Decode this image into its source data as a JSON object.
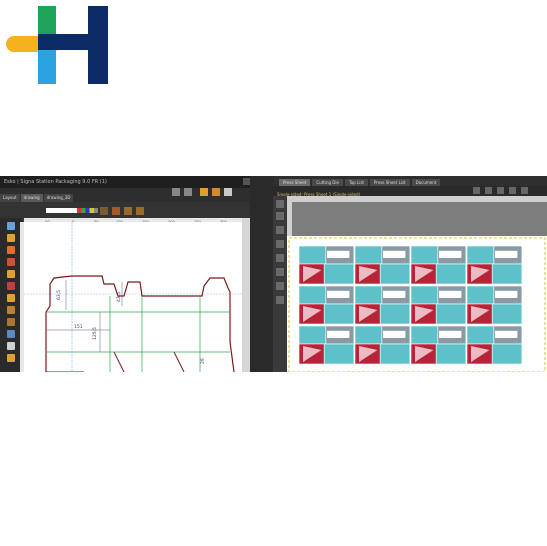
{
  "logo": {
    "name": "H brand logo",
    "colors": [
      "#f5b21c",
      "#2aa3e0",
      "#0b2a66"
    ]
  },
  "left_window": {
    "title": "Esko | Signa Station Packaging 9.0 FR (1)",
    "tabs": [
      "Layout",
      "drawing",
      "drawing_3D"
    ],
    "ruler_ticks": [
      "-50",
      "0",
      "50",
      "100",
      "150",
      "200",
      "250",
      "300"
    ],
    "dimensions": [
      "63,5",
      "43,5",
      "151",
      "125,5",
      "29"
    ]
  },
  "right_window": {
    "tabs": [
      "Press Sheet",
      "Cutting Die",
      "Top List",
      "Press Sheet List",
      "Document"
    ],
    "active_tab": "Press Sheet",
    "sheet_label": "Single-sided: Press Sheet 1 (Single-sided)",
    "grid": {
      "rows": 3,
      "cols": 4
    }
  },
  "colors": {
    "box_cyan": "#5ec1c9",
    "box_red": "#b8233a",
    "box_gray": "#8a9aa4",
    "outline": "#7a1a1a"
  }
}
